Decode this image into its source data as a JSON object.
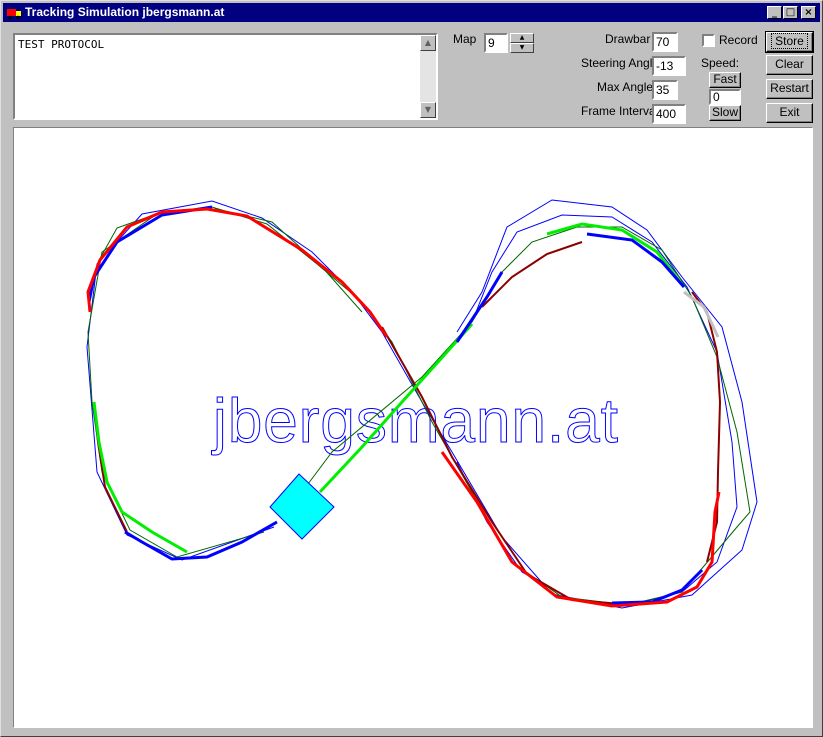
{
  "window": {
    "title": "Tracking Simulation jbergsmann.at",
    "icon": "truck-app-icon",
    "controls": {
      "minimize": "_",
      "maximize": "□",
      "close": "×"
    }
  },
  "protocol": {
    "text": "TEST PROTOCOL"
  },
  "map": {
    "label": "Map",
    "value": "9"
  },
  "params": {
    "drawbar_label": "Drawbar",
    "drawbar_value": "70",
    "steering_label": "Steering Angle",
    "steering_value": "-13",
    "maxangle_label": "Max Angle",
    "maxangle_value": "35",
    "frame_label": "Frame Interval",
    "frame_value": "400"
  },
  "record": {
    "label": "Record",
    "checked": false
  },
  "speed": {
    "label": "Speed:",
    "fast_label": "Fast",
    "value": "0",
    "slow_label": "Slow"
  },
  "buttons": {
    "store": "Store",
    "clear": "Clear",
    "restart": "Restart",
    "exit": "Exit"
  },
  "canvas": {
    "watermark": "jbergsmann.at",
    "colors": {
      "red": "#ff0000",
      "blue": "#0000ff",
      "bright_green": "#00ee00",
      "dark_green": "#006600",
      "dark_red": "#8b0000",
      "gray": "#c0c0c0",
      "vehicle": "#00ffff",
      "watermark": "#0000ff"
    }
  }
}
